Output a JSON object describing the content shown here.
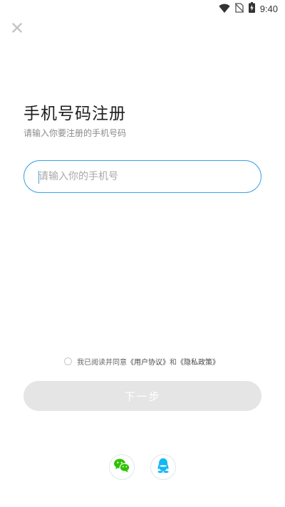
{
  "status_bar": {
    "time": "9:40",
    "icons": [
      "wifi-icon",
      "no-sim-icon",
      "battery-charging-icon"
    ]
  },
  "header": {
    "close_icon": "close-icon"
  },
  "main": {
    "title": "手机号码注册",
    "subtitle": "请输入你要注册的手机号码",
    "phone_input": {
      "placeholder": "请输入你的手机号",
      "value": ""
    },
    "agreement": {
      "prefix": "我已阅读并同意",
      "user_agreement": "《用户协议》",
      "joiner": "和",
      "privacy_policy": "《隐私政策》",
      "checked": false
    },
    "next_button": "下一步"
  },
  "social_login": {
    "items": [
      "wechat-icon",
      "qq-icon"
    ]
  },
  "colors": {
    "accent": "#3aa0e6",
    "button_disabled": "#e5e5e5",
    "wechat": "#2dc100",
    "qq": "#12b7f5"
  }
}
